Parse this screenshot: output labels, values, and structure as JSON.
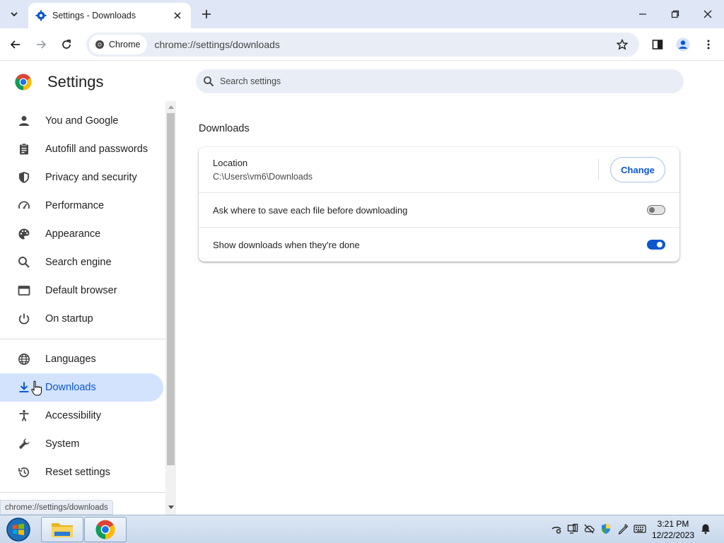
{
  "browser": {
    "tab_title": "Settings - Downloads",
    "omnibox_chip": "Chrome",
    "url": "chrome://settings/downloads"
  },
  "settings": {
    "title": "Settings",
    "search_placeholder": "Search settings"
  },
  "sidebar": {
    "items": [
      {
        "label": "You and Google",
        "icon": "person-icon"
      },
      {
        "label": "Autofill and passwords",
        "icon": "clipboard-icon"
      },
      {
        "label": "Privacy and security",
        "icon": "shield-icon"
      },
      {
        "label": "Performance",
        "icon": "speedometer-icon"
      },
      {
        "label": "Appearance",
        "icon": "palette-icon"
      },
      {
        "label": "Search engine",
        "icon": "search-icon"
      },
      {
        "label": "Default browser",
        "icon": "browser-window-icon"
      },
      {
        "label": "On startup",
        "icon": "power-icon"
      },
      {
        "label": "Languages",
        "icon": "globe-icon"
      },
      {
        "label": "Downloads",
        "icon": "download-icon",
        "active": true
      },
      {
        "label": "Accessibility",
        "icon": "accessibility-icon"
      },
      {
        "label": "System",
        "icon": "wrench-icon"
      },
      {
        "label": "Reset settings",
        "icon": "history-icon"
      }
    ]
  },
  "downloads": {
    "section_title": "Downloads",
    "location_label": "Location",
    "location_value": "C:\\Users\\vm6\\Downloads",
    "change_button": "Change",
    "ask_where_label": "Ask where to save each file before downloading",
    "ask_where_enabled": false,
    "show_downloads_label": "Show downloads when they're done",
    "show_downloads_enabled": true
  },
  "status_bubble": "chrome://settings/downloads",
  "taskbar": {
    "time": "3:21 PM",
    "date": "12/22/2023"
  },
  "colors": {
    "accent": "#0b57d0",
    "active_nav_bg": "#d3e3fd",
    "tabstrip_bg": "#dfe6f5"
  }
}
